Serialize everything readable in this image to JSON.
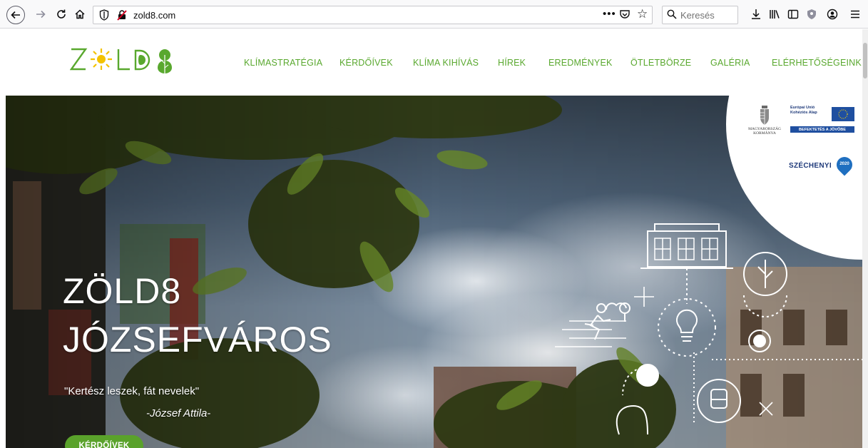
{
  "browser": {
    "url": "zold8.com",
    "search_placeholder": "Keresés"
  },
  "site": {
    "logo_text": "ZÖLD8",
    "nav": [
      {
        "label": "KLÍMASTRATÉGIA"
      },
      {
        "label": "KÉRDŐÍVEK"
      },
      {
        "label": "KLÍMA KIHÍVÁS"
      },
      {
        "label": "HÍREK"
      },
      {
        "label": "EREDMÉNYEK"
      },
      {
        "label": "ÖTLETBÖRZE"
      },
      {
        "label": "GALÉRIA"
      },
      {
        "label": "ELÉRHETŐSÉGEINK"
      }
    ]
  },
  "hero": {
    "title_line1": "ZÖLD8",
    "title_line2": "JÓZSEFVÁROS",
    "quote": "\"Kertész leszek, fát nevelek\"",
    "author": "-József Attila-",
    "button": "KÉRDŐÍVEK"
  },
  "badge": {
    "eu_line1": "Európai Unió",
    "eu_line2": "Kohéziós Alap",
    "gov_line1": "MAGYARORSZÁG",
    "gov_line2": "KORMÁNYA",
    "future": "BEFEKTETÉS A JÖVŐBE",
    "program": "SZÉCHENYI",
    "year": "2020"
  },
  "colors": {
    "brand_green": "#59a82e",
    "button_green": "#5aa22b",
    "eu_blue": "#1f4fa0"
  }
}
